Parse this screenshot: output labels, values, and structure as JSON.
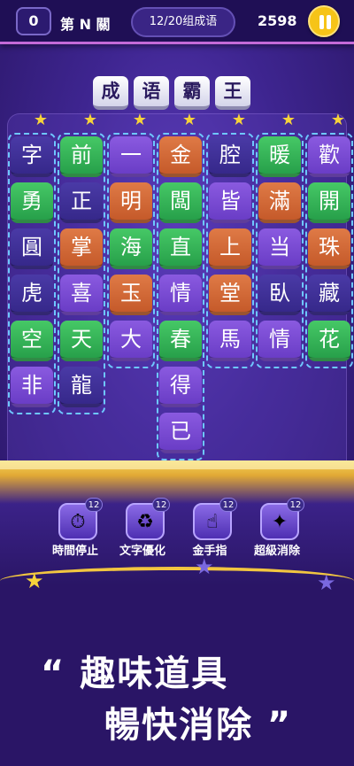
{
  "header": {
    "level_num": "0",
    "level_title": "第 N 關",
    "progress": "12/20组成语",
    "score": "2598"
  },
  "target_word": [
    "成",
    "语",
    "霸",
    "王"
  ],
  "columns": [
    {
      "tiles": [
        {
          "ch": "字",
          "c": "indigo"
        },
        {
          "ch": "勇",
          "c": "green"
        },
        {
          "ch": "圓",
          "c": "indigo"
        },
        {
          "ch": "虎",
          "c": "indigo"
        },
        {
          "ch": "空",
          "c": "green"
        },
        {
          "ch": "非",
          "c": "purple"
        }
      ]
    },
    {
      "tiles": [
        {
          "ch": "前",
          "c": "green"
        },
        {
          "ch": "正",
          "c": "indigo"
        },
        {
          "ch": "掌",
          "c": "orange"
        },
        {
          "ch": "喜",
          "c": "purple"
        },
        {
          "ch": "天",
          "c": "green"
        },
        {
          "ch": "龍",
          "c": "indigo"
        }
      ]
    },
    {
      "tiles": [
        {
          "ch": "一",
          "c": "purple"
        },
        {
          "ch": "明",
          "c": "orange"
        },
        {
          "ch": "海",
          "c": "green"
        },
        {
          "ch": "玉",
          "c": "orange"
        },
        {
          "ch": "大",
          "c": "purple"
        }
      ]
    },
    {
      "tiles": [
        {
          "ch": "金",
          "c": "orange"
        },
        {
          "ch": "闆",
          "c": "green"
        },
        {
          "ch": "直",
          "c": "green"
        },
        {
          "ch": "情",
          "c": "purple"
        },
        {
          "ch": "春",
          "c": "green"
        },
        {
          "ch": "得",
          "c": "purple"
        },
        {
          "ch": "已",
          "c": "purple"
        }
      ]
    },
    {
      "tiles": [
        {
          "ch": "腔",
          "c": "indigo"
        },
        {
          "ch": "皆",
          "c": "purple"
        },
        {
          "ch": "上",
          "c": "orange"
        },
        {
          "ch": "堂",
          "c": "orange"
        },
        {
          "ch": "馬",
          "c": "purple"
        }
      ]
    },
    {
      "tiles": [
        {
          "ch": "暖",
          "c": "green"
        },
        {
          "ch": "滿",
          "c": "orange"
        },
        {
          "ch": "当",
          "c": "purple"
        },
        {
          "ch": "臥",
          "c": "indigo"
        },
        {
          "ch": "情",
          "c": "purple"
        }
      ]
    },
    {
      "tiles": [
        {
          "ch": "歡",
          "c": "purple"
        },
        {
          "ch": "開",
          "c": "green"
        },
        {
          "ch": "珠",
          "c": "orange"
        },
        {
          "ch": "藏",
          "c": "indigo"
        },
        {
          "ch": "花",
          "c": "green"
        }
      ]
    }
  ],
  "powerups": [
    {
      "label": "時間停止",
      "count": "12",
      "icon": "stopwatch-icon",
      "glyph": "⏱"
    },
    {
      "label": "文字優化",
      "count": "12",
      "icon": "recycle-icon",
      "glyph": "♻"
    },
    {
      "label": "金手指",
      "count": "12",
      "icon": "pointing-hand-icon",
      "glyph": "☝"
    },
    {
      "label": "超級消除",
      "count": "12",
      "icon": "magic-wand-icon",
      "glyph": "✦"
    }
  ],
  "promo": {
    "line1": "“ 趣味道具",
    "line2": "暢快消除 ”"
  }
}
